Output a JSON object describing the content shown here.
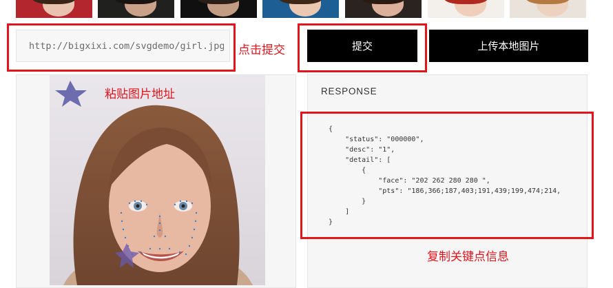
{
  "thumbnails": [
    {
      "name": "face-thumb-1",
      "bg": "#b3262e",
      "skin": "#e9c2b0",
      "hair": "#3a2418"
    },
    {
      "name": "face-thumb-2",
      "bg": "#20201f",
      "skin": "#caa28a",
      "hair": "#1a1410"
    },
    {
      "name": "face-thumb-3",
      "bg": "#101010",
      "skin": "#c39c84",
      "hair": "#2a1f16"
    },
    {
      "name": "face-thumb-4",
      "bg": "#1d5f95",
      "skin": "#eac8b2",
      "hair": "#3d2718"
    },
    {
      "name": "face-thumb-5",
      "bg": "#2b2320",
      "skin": "#dcb09a",
      "hair": "#2a1a12"
    },
    {
      "name": "face-thumb-6",
      "bg": "#f3efeb",
      "skin": "#efcfbc",
      "hair": "#b0291f"
    },
    {
      "name": "face-thumb-7",
      "bg": "#e9e3dc",
      "skin": "#eed2c0",
      "hair": "#b47a42"
    }
  ],
  "url_input": {
    "value": "http://bigxixi.com/svgdemo/girl.jpg"
  },
  "buttons": {
    "submit": "提交",
    "upload": "上传本地图片"
  },
  "annotations": {
    "submit_hint": "点击提交",
    "paste_hint": "粘贴图片地址",
    "copy_hint": "复制关键点信息"
  },
  "response": {
    "title": "RESPONSE",
    "json_text": "{\n    \"status\": \"000000\",\n    \"desc\": \"1\",\n    \"detail\": [\n        {\n            \"face\": \"202 262 280 280 \",\n            \"pts\": \"186,366;187,403;191,439;199,474;214,\n        }\n    ]\n}"
  },
  "colors": {
    "accent_red": "#e2141c",
    "button_bg": "#000000",
    "panel_bg": "#f6f6f6"
  }
}
